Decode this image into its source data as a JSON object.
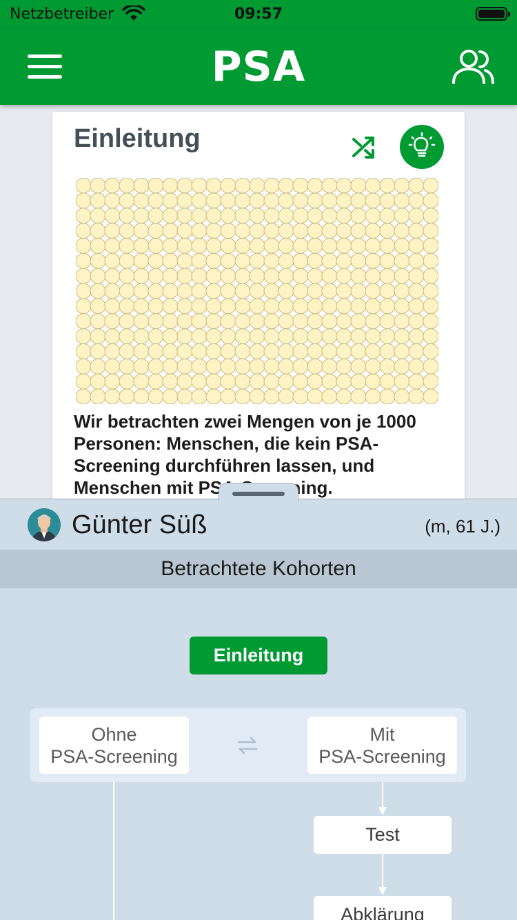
{
  "status_bar": {
    "carrier": "Netzbetreiber",
    "time": "09:57",
    "wifi_icon": "wifi-icon",
    "battery_icon": "battery-icon"
  },
  "nav": {
    "title": "PSA",
    "menu_icon": "hamburger-menu-icon",
    "users_icon": "users-icon"
  },
  "card": {
    "title": "Einleitung",
    "shuffle_icon": "shuffle-icon",
    "hint_icon": "lightbulb-icon",
    "dot_grid": {
      "rows": 15,
      "cols": 25,
      "fill": "#fdf3c5",
      "stroke": "#c9bb7c"
    },
    "text": "Wir betrachten zwei Mengen von je 1000 Personen: Menschen, die kein PSA-Screening durchführen lassen, und Menschen mit PSA-Screening."
  },
  "patient": {
    "name": "Günter Süß",
    "meta": "(m, 61 J.)",
    "avatar_icon": "avatar-icon"
  },
  "sheet": {
    "section_title": "Betrachtete Kohorten",
    "intro_button": "Einleitung",
    "cohort_left": [
      "Ohne",
      "PSA-Screening"
    ],
    "cohort_right": [
      "Mit",
      "PSA-Screening"
    ],
    "swap_icon": "swap-arrows-icon",
    "steps": [
      "Test",
      "Abklärung"
    ]
  },
  "colors": {
    "brand_green": "#009a33",
    "sheet_background": "#cfdde9",
    "section_header": "#b9c7d2"
  }
}
